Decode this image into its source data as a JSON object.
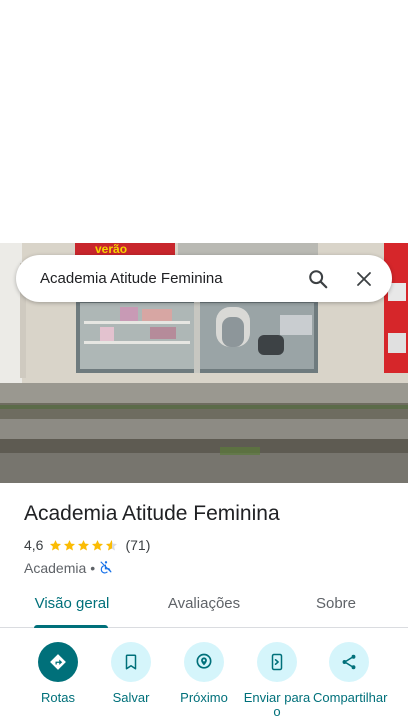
{
  "search": {
    "query": "Academia Atitude Feminina"
  },
  "photo": {
    "sign_text": "verão"
  },
  "place": {
    "name": "Academia Atitude Feminina",
    "rating": "4,6",
    "stars": 4.6,
    "review_count": "(71)",
    "category": "Academia",
    "separator": "•"
  },
  "tabs": [
    {
      "label": "Visão geral",
      "selected": true
    },
    {
      "label": "Avaliações",
      "selected": false
    },
    {
      "label": "Sobre",
      "selected": false
    }
  ],
  "actions": [
    {
      "label": "Rotas",
      "icon": "directions-icon"
    },
    {
      "label": "Salvar",
      "icon": "bookmark-icon"
    },
    {
      "label": "Próximo",
      "icon": "nearby-icon"
    },
    {
      "label": "Enviar para o",
      "icon": "send-to-phone-icon"
    },
    {
      "label": "Compartilhar",
      "icon": "share-icon"
    }
  ],
  "colors": {
    "accent": "#00707a",
    "action_bg": "#d5f5fb",
    "star": "#fbbc04"
  }
}
